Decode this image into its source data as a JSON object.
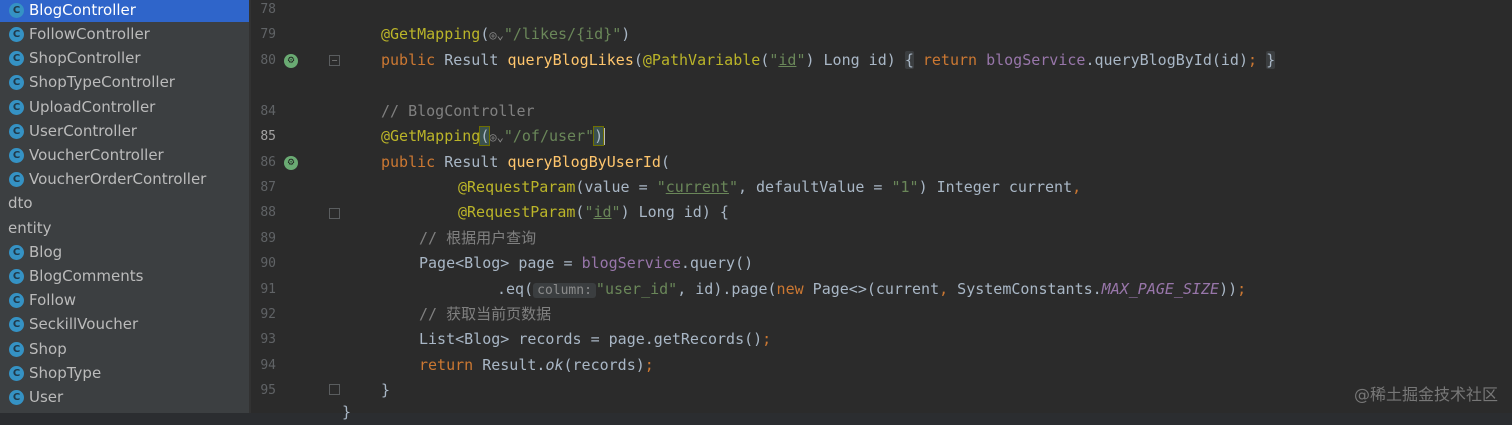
{
  "sidebar": {
    "items": [
      {
        "label": "BlogController",
        "kind": "class",
        "selected": true
      },
      {
        "label": "FollowController",
        "kind": "class"
      },
      {
        "label": "ShopController",
        "kind": "class"
      },
      {
        "label": "ShopTypeController",
        "kind": "class"
      },
      {
        "label": "UploadController",
        "kind": "class"
      },
      {
        "label": "UserController",
        "kind": "class"
      },
      {
        "label": "VoucherController",
        "kind": "class"
      },
      {
        "label": "VoucherOrderController",
        "kind": "class"
      },
      {
        "label": "dto",
        "kind": "package"
      },
      {
        "label": "entity",
        "kind": "package"
      },
      {
        "label": "Blog",
        "kind": "class"
      },
      {
        "label": "BlogComments",
        "kind": "class"
      },
      {
        "label": "Follow",
        "kind": "class"
      },
      {
        "label": "SeckillVoucher",
        "kind": "class"
      },
      {
        "label": "Shop",
        "kind": "class"
      },
      {
        "label": "ShopType",
        "kind": "class"
      },
      {
        "label": "User",
        "kind": "class"
      }
    ],
    "class_icon_letter": "C"
  },
  "gutter": {
    "line_numbers": [
      "78",
      "79",
      "80",
      "84",
      "85",
      "86",
      "87",
      "88",
      "89",
      "90",
      "91",
      "92",
      "93",
      "94",
      "95"
    ],
    "current_line": "85"
  },
  "editor": {
    "l79": {
      "ann": "@GetMapping",
      "open": "(",
      "str": "\"/likes/{id}\"",
      "close": ")"
    },
    "l80": {
      "kw": "public",
      "type": " Result ",
      "fn": "queryBlogLikes",
      "p1": "(",
      "ann": "@PathVariable",
      "p2": "(",
      "s1": "\"",
      "slink": "id",
      "s2": "\"",
      "p3": ") Long id) ",
      "fold_open": "{",
      "kw2": "return",
      "svc": "blogService",
      "rest": ".queryBlogById(id)",
      "semi": ";",
      "fold_close": "}"
    },
    "l84": {
      "comment": "// BlogController"
    },
    "l85": {
      "ann": "@GetMapping",
      "open": "(",
      "str": "\"/of/user\"",
      "close": ")"
    },
    "l86": {
      "kw": "public",
      "type": " Result ",
      "fn": "queryBlogByUserId",
      "rest": "("
    },
    "l87": {
      "ann": "@RequestParam",
      "a": "(value = ",
      "s1": "\"",
      "slink": "current",
      "s2": "\"",
      "b": ", defaultValue = ",
      "s3": "\"1\"",
      "c": ") Integer current",
      "comma": ","
    },
    "l88": {
      "ann": "@RequestParam",
      "a": "(",
      "s1": "\"",
      "slink": "id",
      "s2": "\"",
      "b": ") Long id) {"
    },
    "l89": {
      "comment": "// 根据用户查询"
    },
    "l90": {
      "a": "Page<Blog> page = ",
      "svc": "blogService",
      "b": ".query()"
    },
    "l91": {
      "a": ".eq(",
      "hint": "column:",
      "str": "\"user_id\"",
      "b": ", id).page(",
      "kw": "new",
      "c": " Page<>(current",
      "comma": ",",
      "d": " SystemConstants.",
      "const": "MAX_PAGE_SIZE",
      "e": "))",
      "semi": ";"
    },
    "l92": {
      "comment": "// 获取当前页数据"
    },
    "l93": {
      "a": "List<Blog> records = page.getRecords()",
      "semi": ";"
    },
    "l94": {
      "kw": "return",
      "a": " Result.",
      "it": "ok",
      "b": "(records)",
      "semi": ";"
    },
    "l95": {
      "a": "}"
    },
    "l96": {
      "a": "}"
    }
  },
  "watermark": "@稀土掘金技术社区"
}
